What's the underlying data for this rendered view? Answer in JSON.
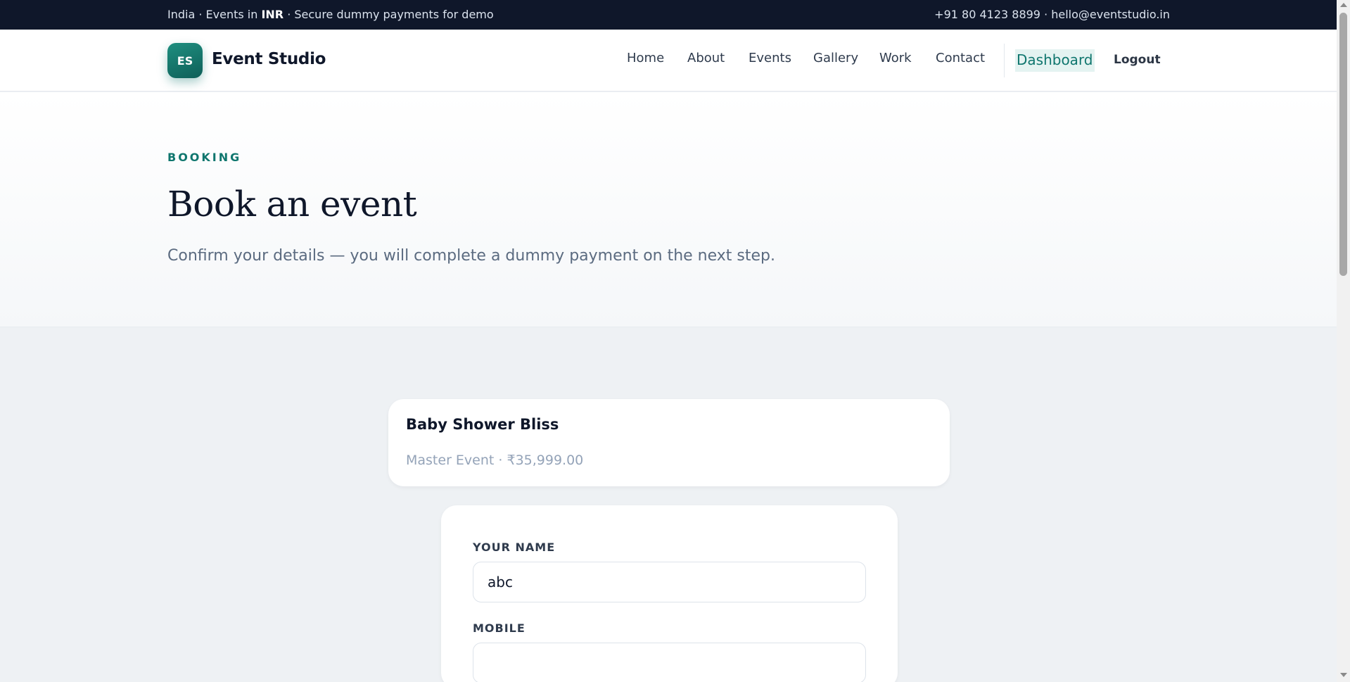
{
  "topbar": {
    "left_prefix": "India · Events in ",
    "left_bold": "INR",
    "left_suffix": " · Secure dummy payments for demo",
    "contact": "+91 80 4123 8899 · hello@eventstudio.in"
  },
  "brand": {
    "badge": "ES",
    "name": "Event Studio",
    "accent_color": "#0f766e"
  },
  "nav": {
    "items": [
      "Home",
      "About",
      "Events",
      "Gallery",
      "Work",
      "Contact"
    ],
    "dashboard": "Dashboard",
    "logout": "Logout"
  },
  "hero": {
    "eyebrow": "BOOKING",
    "title": "Book an event",
    "subtitle": "Confirm your details — you will complete a dummy payment on the next step."
  },
  "event": {
    "name": "Baby Shower Bliss",
    "meta": "Master Event · ₹35,999.00"
  },
  "form": {
    "name_label": "YOUR NAME",
    "name_value": "abc",
    "mobile_label": "MOBILE",
    "mobile_value": ""
  }
}
